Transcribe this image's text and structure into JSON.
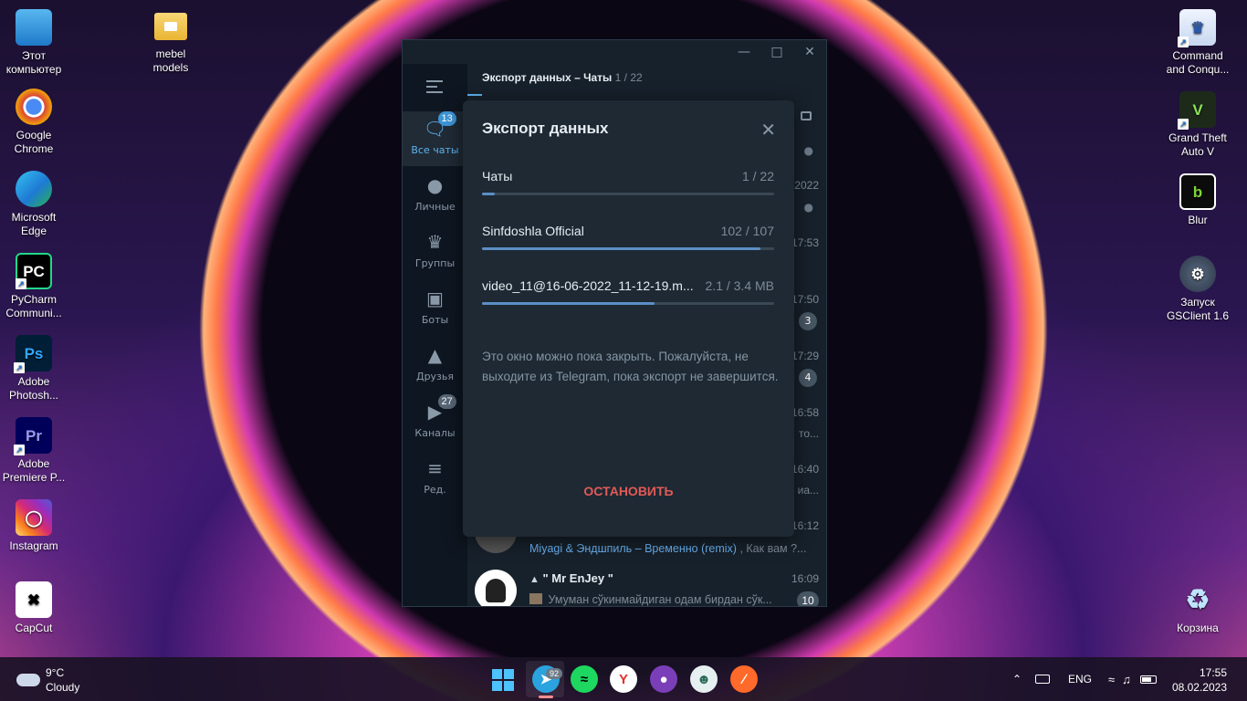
{
  "desktop_left": [
    {
      "label": "Этот компьютер",
      "icon": "monitor-icon"
    },
    {
      "label": "Google Chrome",
      "icon": "chrome-icon"
    },
    {
      "label": "Microsoft Edge",
      "icon": "edge-icon"
    },
    {
      "label": "PyCharm Communi...",
      "icon": "pycharm-icon"
    },
    {
      "label": "Adobe Photosh...",
      "icon": "photoshop-icon"
    },
    {
      "label": "Adobe Premiere P...",
      "icon": "premiere-icon"
    },
    {
      "label": "Instagram",
      "icon": "instagram-icon"
    },
    {
      "label": "CapCut",
      "icon": "capcut-icon"
    }
  ],
  "desktop_second": {
    "label": "mebel models",
    "icon": "folder-icon"
  },
  "desktop_right": [
    {
      "label": "Command and Conqu...",
      "icon": "command-conquer-icon"
    },
    {
      "label": "Grand Theft Auto V",
      "icon": "gta-icon"
    },
    {
      "label": "Blur",
      "icon": "blur-icon"
    },
    {
      "label": "Запуск GSClient 1.6",
      "icon": "gsclient-icon"
    },
    {
      "label": "Корзина",
      "icon": "recycle-bin-icon"
    }
  ],
  "telegram": {
    "breadcrumb": "Экспорт данных – Чаты",
    "breadcrumb_count": "1 / 22",
    "rail": [
      {
        "label": "Все чаты",
        "icon": "chats-icon",
        "badge": "13",
        "active": true
      },
      {
        "label": "Личные",
        "icon": "person-icon",
        "badge": "",
        "active": false
      },
      {
        "label": "Группы",
        "icon": "crown-icon",
        "badge": "",
        "active": false
      },
      {
        "label": "Боты",
        "icon": "bot-icon",
        "badge": "",
        "active": false
      },
      {
        "label": "Друзья",
        "icon": "graduation-cap-icon",
        "badge": "",
        "active": false
      },
      {
        "label": "Каналы",
        "icon": "megaphone-icon",
        "badge": "27",
        "active": false
      },
      {
        "label": "Ред.",
        "icon": "sliders-icon",
        "badge": "",
        "active": false
      }
    ],
    "peek": {
      "times": [
        "2022",
        "17:53",
        "17:50",
        "17:29",
        "16:58",
        "16:40",
        "16:12"
      ],
      "badges": [
        "3",
        "4"
      ],
      "snips": [
        "то...",
        "иа..."
      ]
    },
    "miyagi_line": "Miyagi & Эндшпиль – Временно (remix)",
    "miyagi_tail": ", Как вам ?...",
    "mr_enjey": {
      "name": "\" Mr EnJey \"",
      "time": "16:09",
      "message": "Умуман сўкинмайдиган одам бирдан сўк...",
      "badge": "10"
    }
  },
  "export_dialog": {
    "title": "Экспорт данных",
    "rows": [
      {
        "label": "Чаты",
        "value": "1 / 22",
        "progress": 0.045
      },
      {
        "label": "Sinfdoshla Official",
        "value": "102 / 107",
        "progress": 0.953
      },
      {
        "label": "video_11@16-06-2022_11-12-19.m...",
        "value": "2.1 / 3.4 MB",
        "progress": 0.59
      }
    ],
    "note": "Это окно можно пока закрыть. Пожалуйста, не выходите из Telegram, пока экспорт не завершится.",
    "stop_label": "ОСТАНОВИТЬ"
  },
  "taskbar": {
    "weather_temp": "9°C",
    "weather_desc": "Cloudy",
    "telegram_badge": "92",
    "apps": [
      "windows-start-icon",
      "telegram-icon",
      "spotify-icon",
      "yandex-browser-icon",
      "github-desktop-icon",
      "gsclient-icon",
      "safari-like-icon"
    ],
    "lang": "ENG",
    "time": "17:55",
    "date": "08.02.2023"
  }
}
